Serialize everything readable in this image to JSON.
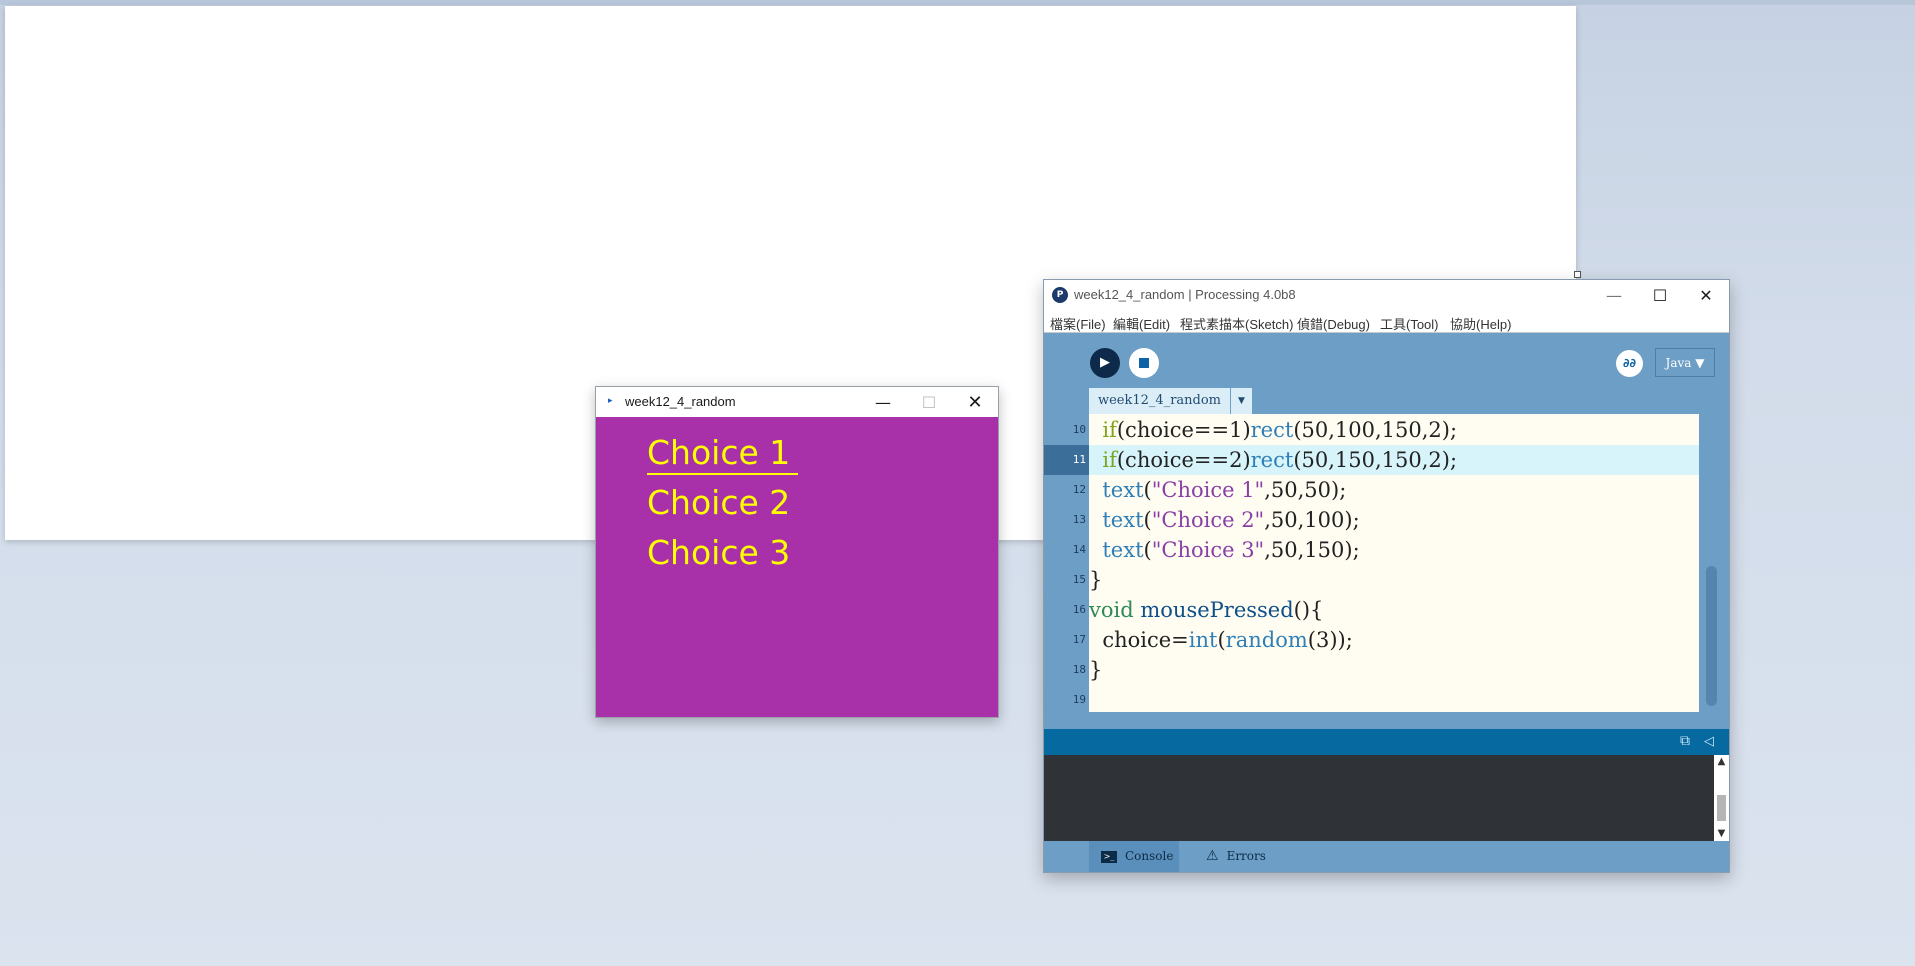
{
  "sketch_window": {
    "title": "week12_4_random",
    "choices": [
      "Choice 1",
      "Choice 2",
      "Choice 3"
    ],
    "colors": {
      "background": "#a830a8",
      "text": "#ffff00"
    }
  },
  "ide": {
    "title": "week12_4_random | Processing 4.0b8",
    "menu": [
      "檔案(File)",
      "編輯(Edit)",
      "程式素描本(Sketch)",
      "偵錯(Debug)",
      "工具(Tool)",
      "協助(Help)"
    ],
    "mode": "Java ▼",
    "tab": "week12_4_random",
    "code_lines": [
      {
        "num": "10",
        "parts": [
          {
            "t": "  "
          },
          {
            "t": "if",
            "c": "#7fa31f"
          },
          {
            "t": "(choice==1)"
          },
          {
            "t": "rect",
            "c": "#2f7fb8"
          },
          {
            "t": "(50,100,150,2);"
          }
        ]
      },
      {
        "num": "11",
        "parts": [
          {
            "t": "  "
          },
          {
            "t": "if",
            "c": "#7fa31f"
          },
          {
            "t": "(choice==2)"
          },
          {
            "t": "rect",
            "c": "#2f7fb8"
          },
          {
            "t": "(50,150,150,2);"
          }
        ],
        "highlight": true
      },
      {
        "num": "12",
        "parts": [
          {
            "t": "  "
          },
          {
            "t": "text",
            "c": "#2f7fb8"
          },
          {
            "t": "("
          },
          {
            "t": "\"Choice 1\"",
            "c": "#8a3fa8"
          },
          {
            "t": ",50,50);"
          }
        ]
      },
      {
        "num": "13",
        "parts": [
          {
            "t": "  "
          },
          {
            "t": "text",
            "c": "#2f7fb8"
          },
          {
            "t": "("
          },
          {
            "t": "\"Choice 2\"",
            "c": "#8a3fa8"
          },
          {
            "t": ",50,100);"
          }
        ]
      },
      {
        "num": "14",
        "parts": [
          {
            "t": "  "
          },
          {
            "t": "text",
            "c": "#2f7fb8"
          },
          {
            "t": "("
          },
          {
            "t": "\"Choice 3\"",
            "c": "#8a3fa8"
          },
          {
            "t": ",50,150);"
          }
        ]
      },
      {
        "num": "15",
        "parts": [
          {
            "t": "}"
          }
        ]
      },
      {
        "num": "16",
        "parts": [
          {
            "t": "void",
            "c": "#2e8b57"
          },
          {
            "t": " "
          },
          {
            "t": "mousePressed",
            "c": "#0d4f8a"
          },
          {
            "t": "(){"
          }
        ]
      },
      {
        "num": "17",
        "parts": [
          {
            "t": "  choice="
          },
          {
            "t": "int",
            "c": "#2f7fb8"
          },
          {
            "t": "("
          },
          {
            "t": "random",
            "c": "#2f7fb8"
          },
          {
            "t": "(3));"
          }
        ]
      },
      {
        "num": "18",
        "parts": [
          {
            "t": "}"
          }
        ]
      },
      {
        "num": "19",
        "parts": [
          {
            "t": ""
          }
        ]
      }
    ],
    "footer_tabs": {
      "console": "Console",
      "errors": "Errors"
    }
  }
}
